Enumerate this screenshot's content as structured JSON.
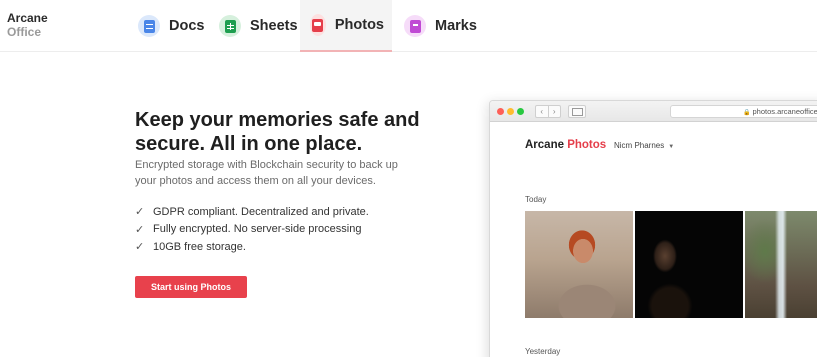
{
  "brand": {
    "line1": "Arcane",
    "line2": "Office"
  },
  "tabs": [
    {
      "label": "Docs",
      "icon": "docs-icon",
      "color": "#4a86e8",
      "active": false
    },
    {
      "label": "Sheets",
      "icon": "sheets-icon",
      "color": "#1e9e4f",
      "active": false
    },
    {
      "label": "Photos",
      "icon": "photos-icon",
      "color": "#e53e4a",
      "active": true
    },
    {
      "label": "Marks",
      "icon": "marks-icon",
      "color": "#c04ad4",
      "active": false
    }
  ],
  "hero": {
    "headline": "Keep your memories safe and secure. All in one place.",
    "subtitle": "Encrypted storage with Blockchain security to back up your photos and access them on all your devices.",
    "features": [
      "GDPR compliant. Decentralized and private.",
      "Fully encrypted. No server-side processing",
      "10GB free storage."
    ],
    "cta_label": "Start using Photos",
    "cta_color": "#e8414c"
  },
  "mockup": {
    "url": "photos.arcaneoffice",
    "app_name": "Arcane",
    "app_name_accent": "Photos",
    "user": "Nicm Pharnes",
    "sections": {
      "today": "Today",
      "yesterday": "Yesterday"
    }
  }
}
